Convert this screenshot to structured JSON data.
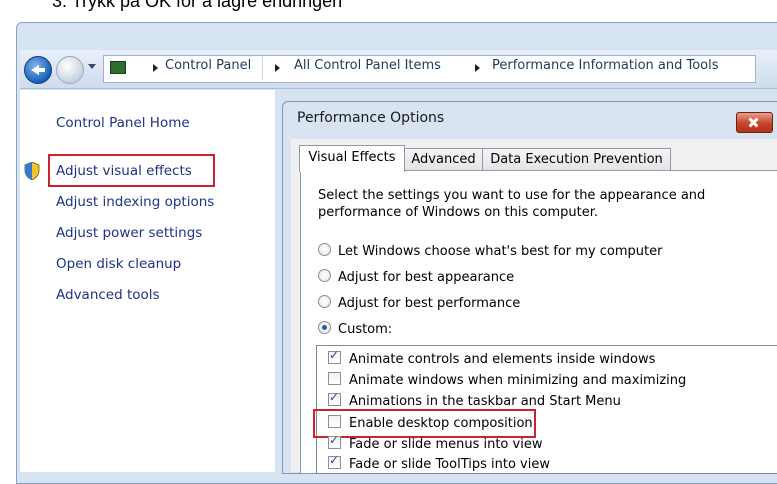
{
  "caption": "3.    Trykk på OK for å lagre endringen",
  "breadcrumb": {
    "items": [
      "Control Panel",
      "All Control Panel Items",
      "Performance Information and Tools"
    ]
  },
  "sidebar": {
    "home": "Control Panel Home",
    "items": [
      {
        "label": "Adjust visual effects",
        "highlighted": true
      },
      {
        "label": "Adjust indexing options"
      },
      {
        "label": "Adjust power settings"
      },
      {
        "label": "Open disk cleanup"
      },
      {
        "label": "Advanced tools"
      }
    ]
  },
  "dialog": {
    "title": "Performance Options",
    "tabs": [
      "Visual Effects",
      "Advanced",
      "Data Execution Prevention"
    ],
    "active_tab": "Visual Effects",
    "description": "Select the settings you want to use for the appearance and performance of Windows on this computer.",
    "radios": [
      {
        "label": "Let Windows choose what's best for my computer",
        "selected": false
      },
      {
        "label": "Adjust for best appearance",
        "selected": false
      },
      {
        "label": "Adjust for best performance",
        "selected": false
      },
      {
        "label": "Custom:",
        "selected": true
      }
    ],
    "checkboxes": [
      {
        "label": "Animate controls and elements inside windows",
        "checked": true
      },
      {
        "label": "Animate windows when minimizing and maximizing",
        "checked": false
      },
      {
        "label": "Animations in the taskbar and Start Menu",
        "checked": true
      },
      {
        "label": "Enable desktop composition",
        "checked": false,
        "highlighted": true
      },
      {
        "label": "Fade or slide menus into view",
        "checked": true
      },
      {
        "label": "Fade or slide ToolTips into view",
        "checked": true
      }
    ]
  },
  "colors": {
    "highlight": "#c8242f",
    "link": "#1e3287"
  }
}
